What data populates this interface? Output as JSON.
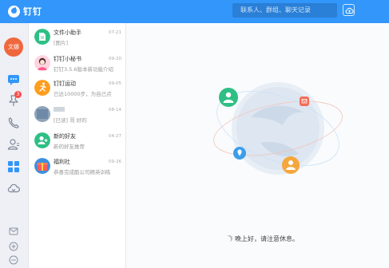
{
  "app": {
    "name": "钉钉"
  },
  "header": {
    "search_placeholder": "联系人、群组、聊天记录"
  },
  "user": {
    "avatar_text": "文娜"
  },
  "leftnav": {
    "todo_badge": "3",
    "items": [
      "messages-icon",
      "ding-icon",
      "phone-icon",
      "contacts-icon",
      "workbench-icon",
      "cloud-disk-icon",
      "mail-icon",
      "add-icon",
      "more-icon"
    ]
  },
  "conversations": [
    {
      "name": "文件小助手",
      "message": "[图片]",
      "time": "07-21",
      "avatar_color": "#2fbf85"
    },
    {
      "name": "钉钉小秘书",
      "message": "钉钉3.5.6版本新功能介绍",
      "time": "09-20",
      "avatar_color": "#ff7da6"
    },
    {
      "name": "钉钉运动",
      "message": "已达10000步，为自己点",
      "time": "09-05",
      "avatar_color": "#ff9d1f"
    },
    {
      "name": "",
      "message": "[已读] 哥 好的",
      "time": "08-14",
      "avatar_color": "#6e8aa8"
    },
    {
      "name": "新的好友",
      "message": "新的好友推荐",
      "time": "04-27",
      "avatar_color": "#2fbf85"
    },
    {
      "name": "福利社",
      "message": "恭喜完成酷公司精英训练",
      "time": "09-26",
      "avatar_color": "#3d8fe0"
    }
  ],
  "main": {
    "greeting": "晚上好，请注意休息。"
  },
  "colors": {
    "brand": "#3296fa",
    "green": "#2fbf85",
    "orange": "#ff9d1f",
    "red": "#f0673e"
  }
}
